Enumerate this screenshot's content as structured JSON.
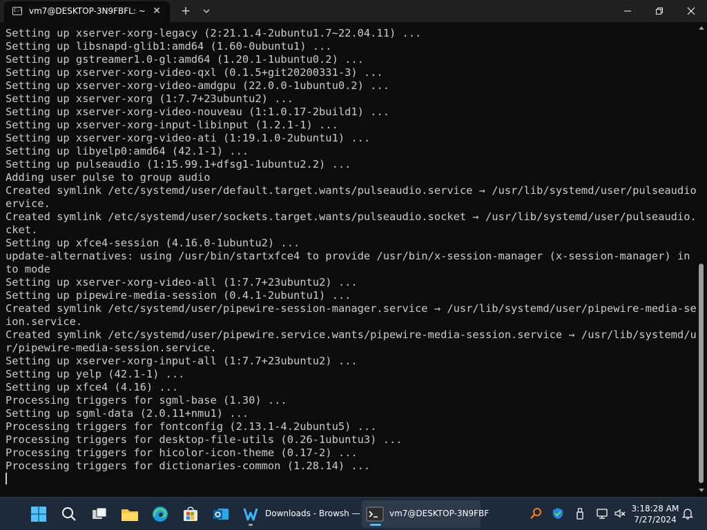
{
  "window": {
    "tab_title": "vm7@DESKTOP-3N9FBFL: ~",
    "tab_icon": "terminal-icon",
    "new_tab_symbol": "+",
    "close_tab_symbol": "✕"
  },
  "terminal": {
    "lines": [
      "Setting up xserver-xorg-legacy (2:21.1.4-2ubuntu1.7~22.04.11) ...",
      "Setting up libsnapd-glib1:amd64 (1.60-0ubuntu1) ...",
      "Setting up gstreamer1.0-gl:amd64 (1.20.1-1ubuntu0.2) ...",
      "Setting up xserver-xorg-video-qxl (0.1.5+git20200331-3) ...",
      "Setting up xserver-xorg-video-amdgpu (22.0.0-1ubuntu0.2) ...",
      "Setting up xserver-xorg (1:7.7+23ubuntu2) ...",
      "Setting up xserver-xorg-video-nouveau (1:1.0.17-2build1) ...",
      "Setting up xserver-xorg-input-libinput (1.2.1-1) ...",
      "Setting up xserver-xorg-video-ati (1:19.1.0-2ubuntu1) ...",
      "Setting up libyelp0:amd64 (42.1-1) ...",
      "Setting up pulseaudio (1:15.99.1+dfsg1-1ubuntu2.2) ...",
      "Adding user pulse to group audio",
      "Created symlink /etc/systemd/user/default.target.wants/pulseaudio.service → /usr/lib/systemd/user/pulseaudio.s",
      "ervice.",
      "Created symlink /etc/systemd/user/sockets.target.wants/pulseaudio.socket → /usr/lib/systemd/user/pulseaudio.so",
      "cket.",
      "Setting up xfce4-session (4.16.0-1ubuntu2) ...",
      "update-alternatives: using /usr/bin/startxfce4 to provide /usr/bin/x-session-manager (x-session-manager) in au",
      "to mode",
      "Setting up xserver-xorg-video-all (1:7.7+23ubuntu2) ...",
      "Setting up pipewire-media-session (0.4.1-2ubuntu1) ...",
      "Created symlink /etc/systemd/user/pipewire-session-manager.service → /usr/lib/systemd/user/pipewire-media-sess",
      "ion.service.",
      "Created symlink /etc/systemd/user/pipewire.service.wants/pipewire-media-session.service → /usr/lib/systemd/use",
      "r/pipewire-media-session.service.",
      "Setting up xserver-xorg-input-all (1:7.7+23ubuntu2) ...",
      "Setting up yelp (42.1-1) ...",
      "Setting up xfce4 (4.16) ...",
      "Processing triggers for sgml-base (1.30) ...",
      "Setting up sgml-data (2.0.11+nmu1) ...",
      "Processing triggers for fontconfig (2.13.1-4.2ubuntu5) ...",
      "Processing triggers for desktop-file-utils (0.26-1ubuntu3) ...",
      "Processing triggers for hicolor-icon-theme (0.17-2) ...",
      "Processing triggers for dictionaries-common (1.28.14) ..."
    ]
  },
  "taskbar": {
    "apps": [
      {
        "name": "start",
        "icon": "windows-start-icon"
      },
      {
        "name": "search",
        "icon": "search-icon"
      },
      {
        "name": "task-view",
        "icon": "task-view-icon"
      },
      {
        "name": "file-explorer",
        "icon": "folder-icon"
      },
      {
        "name": "edge",
        "icon": "edge-icon"
      },
      {
        "name": "store",
        "icon": "store-icon"
      },
      {
        "name": "outlook",
        "icon": "outlook-icon"
      }
    ],
    "running": [
      {
        "label": "Downloads - Browsh —",
        "icon": "w-app-icon"
      },
      {
        "label": "vm7@DESKTOP-3N9FBF",
        "icon": "terminal-icon"
      }
    ],
    "tray": [
      "search-highlight-icon",
      "defender-icon",
      "usb-icon",
      "network-icon",
      "volume-muted-icon"
    ],
    "clock": {
      "time": "3:18:28 AM",
      "date": "7/27/2024"
    },
    "notification_icon": "bell-icon"
  },
  "colors": {
    "terminal_bg": "#0c0c0c",
    "terminal_fg": "#cccccc",
    "titlebar_bg": "#202020",
    "taskbar_bg": "#1c2a3a",
    "accent": "#4cc2ff"
  }
}
